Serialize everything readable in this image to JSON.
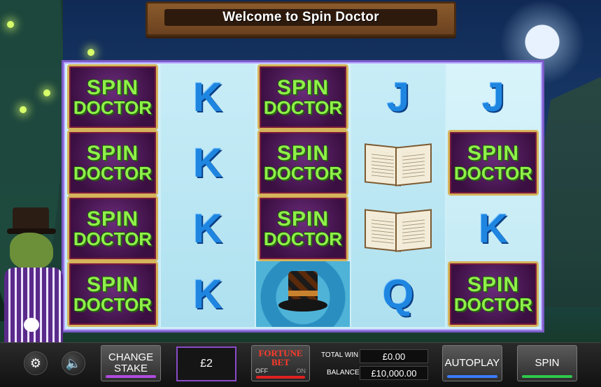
{
  "title": "Welcome to Spin Doctor",
  "symbols": {
    "logo_line1": "SPIN",
    "logo_line2": "DOCTOR"
  },
  "reels": [
    [
      "logo",
      "logo",
      "logo",
      "logo"
    ],
    [
      "K",
      "K",
      "K",
      "K"
    ],
    [
      "logo",
      "logo",
      "logo",
      "hat"
    ],
    [
      "J",
      "book",
      "book",
      "Q"
    ],
    [
      "J",
      "logo",
      "K",
      "logo"
    ]
  ],
  "controls": {
    "settings_icon": "gear-icon",
    "sound_icon": "speaker-icon",
    "change_stake_line1": "CHANGE",
    "change_stake_line2": "STAKE",
    "stake_value": "£2",
    "fortune_bet_line1": "FORTUNE",
    "fortune_bet_line2": "BET",
    "fortune_off": "OFF",
    "fortune_on": "ON",
    "total_win_label": "TOTAL WIN",
    "total_win_value": "£0.00",
    "balance_label": "BALANCE",
    "balance_value": "£10,000.00",
    "autoplay_label": "AUTOPLAY",
    "spin_label": "SPIN"
  },
  "colors": {
    "change_stake_accent": "#b04ae0",
    "autoplay_accent": "#3a7bff",
    "spin_accent": "#2ec84a",
    "fortune_toggle": "#e02020"
  }
}
